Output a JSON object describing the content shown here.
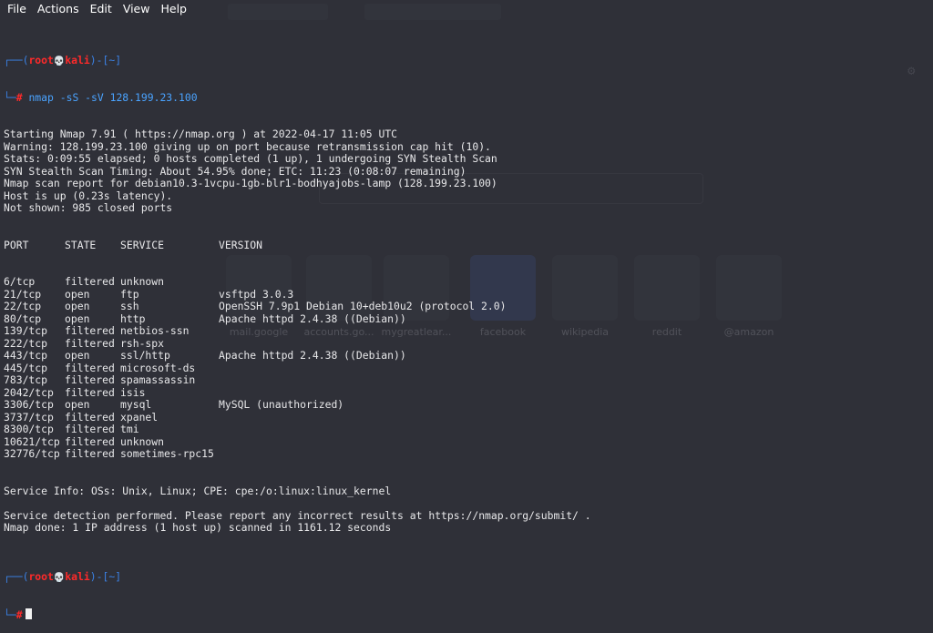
{
  "menu": [
    "File",
    "Actions",
    "Edit",
    "View",
    "Help"
  ],
  "prompt": {
    "open": "┌──(",
    "user": "root",
    "skull": "💀",
    "host": "kali",
    "close_path": ")-[~]",
    "second": "└─",
    "hash": "#"
  },
  "command": "nmap -sS -sV 128.199.23.100",
  "output_pre": [
    "Starting Nmap 7.91 ( https://nmap.org ) at 2022-04-17 11:05 UTC",
    "Warning: 128.199.23.100 giving up on port because retransmission cap hit (10).",
    "Stats: 0:09:55 elapsed; 0 hosts completed (1 up), 1 undergoing SYN Stealth Scan",
    "SYN Stealth Scan Timing: About 54.95% done; ETC: 11:23 (0:08:07 remaining)",
    "Nmap scan report for debian10.3-1vcpu-1gb-blr1-bodhyajobs-lamp (128.199.23.100)",
    "Host is up (0.23s latency).",
    "Not shown: 985 closed ports"
  ],
  "ports_header": [
    "PORT",
    "STATE",
    "SERVICE",
    "VERSION"
  ],
  "ports": [
    [
      "6/tcp",
      "filtered",
      "unknown",
      ""
    ],
    [
      "21/tcp",
      "open",
      "ftp",
      "vsftpd 3.0.3"
    ],
    [
      "22/tcp",
      "open",
      "ssh",
      "OpenSSH 7.9p1 Debian 10+deb10u2 (protocol 2.0)"
    ],
    [
      "80/tcp",
      "open",
      "http",
      "Apache httpd 2.4.38 ((Debian))"
    ],
    [
      "139/tcp",
      "filtered",
      "netbios-ssn",
      ""
    ],
    [
      "222/tcp",
      "filtered",
      "rsh-spx",
      ""
    ],
    [
      "443/tcp",
      "open",
      "ssl/http",
      "Apache httpd 2.4.38 ((Debian))"
    ],
    [
      "445/tcp",
      "filtered",
      "microsoft-ds",
      ""
    ],
    [
      "783/tcp",
      "filtered",
      "spamassassin",
      ""
    ],
    [
      "2042/tcp",
      "filtered",
      "isis",
      ""
    ],
    [
      "3306/tcp",
      "open",
      "mysql",
      "MySQL (unauthorized)"
    ],
    [
      "3737/tcp",
      "filtered",
      "xpanel",
      ""
    ],
    [
      "8300/tcp",
      "filtered",
      "tmi",
      ""
    ],
    [
      "10621/tcp",
      "filtered",
      "unknown",
      ""
    ],
    [
      "32776/tcp",
      "filtered",
      "sometimes-rpc15",
      ""
    ]
  ],
  "output_post": [
    "Service Info: OSs: Unix, Linux; CPE: cpe:/o:linux:linux_kernel",
    "",
    "Service detection performed. Please report any incorrect results at https://nmap.org/submit/ .",
    "Nmap done: 1 IP address (1 host up) scanned in 1161.12 seconds",
    ""
  ],
  "background_browser": {
    "tiles": [
      "mail.google",
      "accounts.go...",
      "mygreatlear...",
      "facebook",
      "wikipedia",
      "reddit",
      "@amazon"
    ]
  }
}
